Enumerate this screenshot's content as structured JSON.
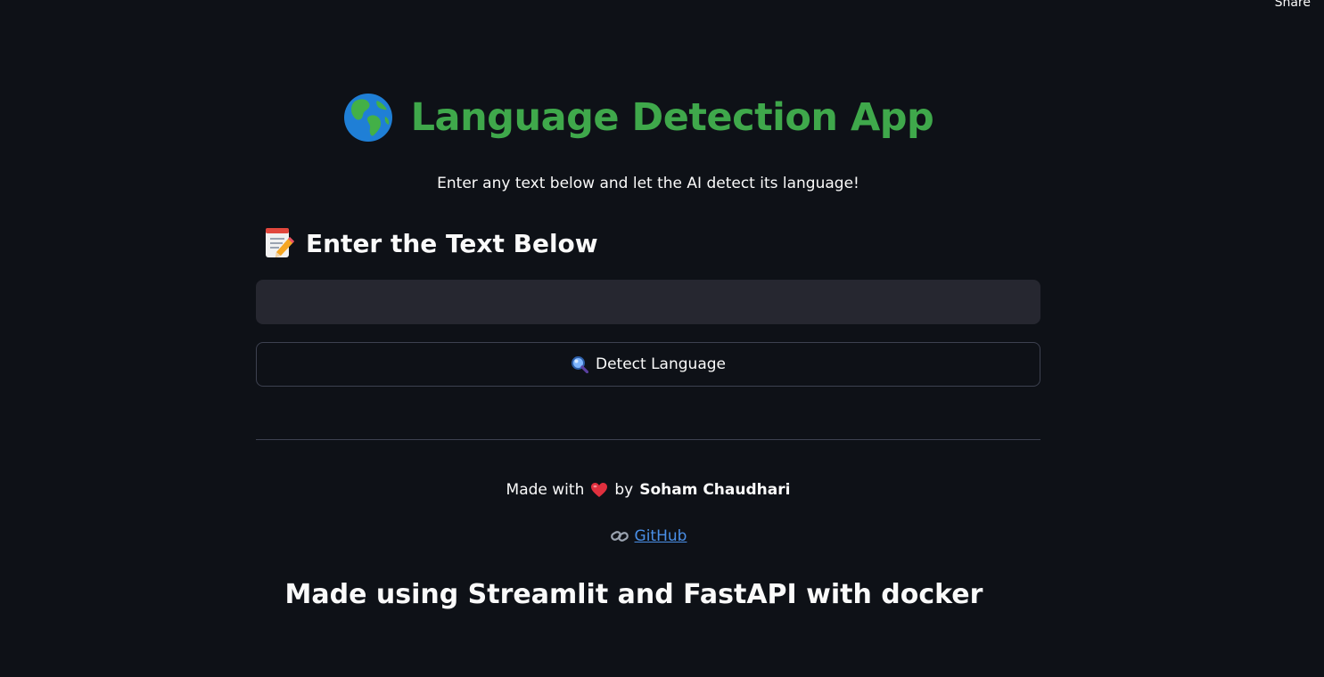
{
  "header": {
    "share_label": "Share"
  },
  "main": {
    "title_icon": "globe-icon",
    "title": "Language Detection App",
    "subtitle": "Enter any text below and let the AI detect its language!",
    "section_icon": "memo-icon",
    "section_heading": "Enter the Text Below",
    "text_input": {
      "value": "",
      "placeholder": ""
    },
    "detect_button": {
      "icon": "magnifier-icon",
      "label": "Detect Language"
    }
  },
  "footer": {
    "made_with_prefix": "Made with",
    "heart_icon": "heart-icon",
    "made_with_by": "by",
    "author": "Soham Chaudhari",
    "github_icon": "link-icon",
    "github_label": "GitHub",
    "tech_note": "Made using Streamlit and FastAPI with docker"
  },
  "colors": {
    "background": "#0e1117",
    "title_green": "#3fa84b",
    "input_background": "#262730",
    "link_blue": "#4a8fe7",
    "border": "#3d4150"
  }
}
